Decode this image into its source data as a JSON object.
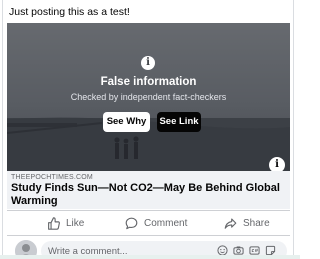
{
  "post": {
    "text": "Just posting this as a test!"
  },
  "fact_check": {
    "title": "False information",
    "subtitle": "Checked by independent fact-checkers",
    "see_why_label": "See Why",
    "see_link_label": "See Link",
    "info_glyph": "i"
  },
  "link_preview": {
    "domain": "THEEPOCHTIMES.COM",
    "headline": "Study Finds Sun—Not CO2—May Be Behind Global Warming"
  },
  "actions": {
    "like_label": "Like",
    "comment_label": "Comment",
    "share_label": "Share"
  },
  "composer": {
    "placeholder": "Write a comment..."
  },
  "icons": {
    "info": "info-icon",
    "like": "thumbs-up-icon",
    "comment": "speech-bubble-icon",
    "share": "share-arrow-icon",
    "emoji": "emoji-icon",
    "camera": "camera-icon",
    "gif": "gif-icon",
    "sticker": "sticker-icon"
  },
  "colors": {
    "overlay": "#23262c",
    "see_why_bg": "#ffffff",
    "see_link_bg": "#050505",
    "secondary_text": "#65676b",
    "preview_bg": "#f0f2f5"
  }
}
